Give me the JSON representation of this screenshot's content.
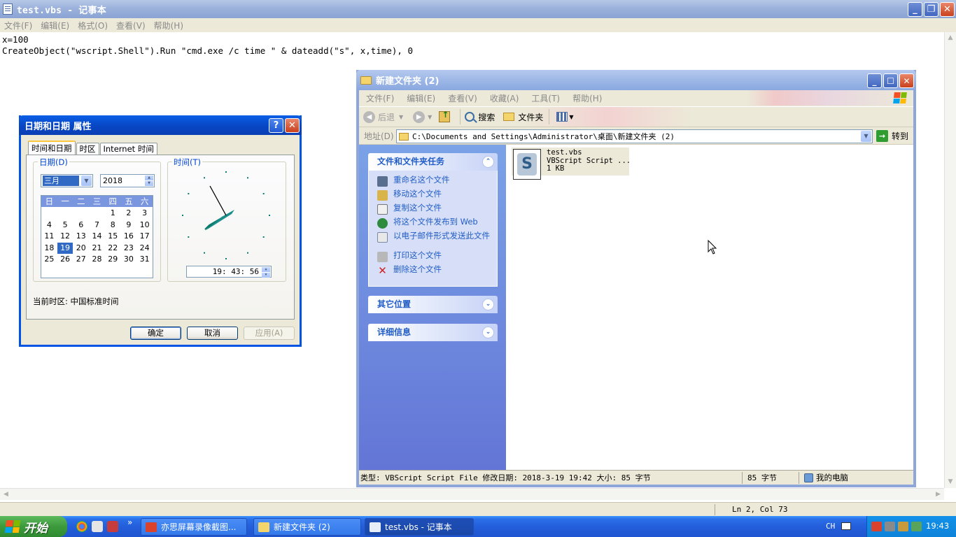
{
  "notepad": {
    "title": "test.vbs - 记事本",
    "menu": [
      "文件(F)",
      "编辑(E)",
      "格式(O)",
      "查看(V)",
      "帮助(H)"
    ],
    "lines": [
      "x=100",
      "CreateObject(\"wscript.Shell\").Run \"cmd.exe /c time \" & dateadd(\"s\", x,time), 0"
    ],
    "status_position": "Ln 2, Col 73"
  },
  "datetime_dialog": {
    "title": "日期和日期 属性",
    "tabs": [
      "时间和日期",
      "时区",
      "Internet 时间"
    ],
    "date_group_label": "日期(D)",
    "time_group_label": "时间(T)",
    "month": "三月",
    "year": "2018",
    "weekdays": [
      "日",
      "一",
      "二",
      "三",
      "四",
      "五",
      "六"
    ],
    "calendar_days": [
      "",
      "",
      "",
      "",
      "1",
      "2",
      "3",
      "4",
      "5",
      "6",
      "7",
      "8",
      "9",
      "10",
      "11",
      "12",
      "13",
      "14",
      "15",
      "16",
      "17",
      "18",
      "19",
      "20",
      "21",
      "22",
      "23",
      "24",
      "25",
      "26",
      "27",
      "28",
      "29",
      "30",
      "31"
    ],
    "selected_day": "19",
    "time": "19: 43: 56",
    "timezone_text": "当前时区: 中国标准时间",
    "buttons": {
      "ok": "确定",
      "cancel": "取消",
      "apply": "应用(A)"
    }
  },
  "explorer": {
    "title": "新建文件夹 (2)",
    "menu": [
      "文件(F)",
      "编辑(E)",
      "查看(V)",
      "收藏(A)",
      "工具(T)",
      "帮助(H)"
    ],
    "toolbar": {
      "back": "后退",
      "search": "搜索",
      "folders": "文件夹"
    },
    "address_label": "地址(D)",
    "address_path": "C:\\Documents and Settings\\Administrator\\桌面\\新建文件夹 (2)",
    "go_label": "转到",
    "file_tasks_title": "文件和文件夹任务",
    "tasks": [
      "重命名这个文件",
      "移动这个文件",
      "复制这个文件",
      "将这个文件发布到 Web",
      "以电子邮件形式发送此文件",
      "打印这个文件",
      "删除这个文件"
    ],
    "other_places_title": "其它位置",
    "details_title": "详细信息",
    "file": {
      "name": "test.vbs",
      "type": "VBScript Script ...",
      "size": "1 KB"
    },
    "status_main": "类型: VBScript Script File 修改日期: 2018-3-19 19:42 大小: 85 字节",
    "status_size": "85 字节",
    "status_location": "我的电脑"
  },
  "taskbar": {
    "start_label": "开始",
    "buttons": [
      "亦思屏幕录像截图...",
      "新建文件夹 (2)",
      "test.vbs - 记事本"
    ],
    "language": "CH",
    "clock": "19:43"
  },
  "colors": {
    "xp_blue": "#0054e3",
    "selection": "#316ac5",
    "task_link": "#215dc6"
  }
}
